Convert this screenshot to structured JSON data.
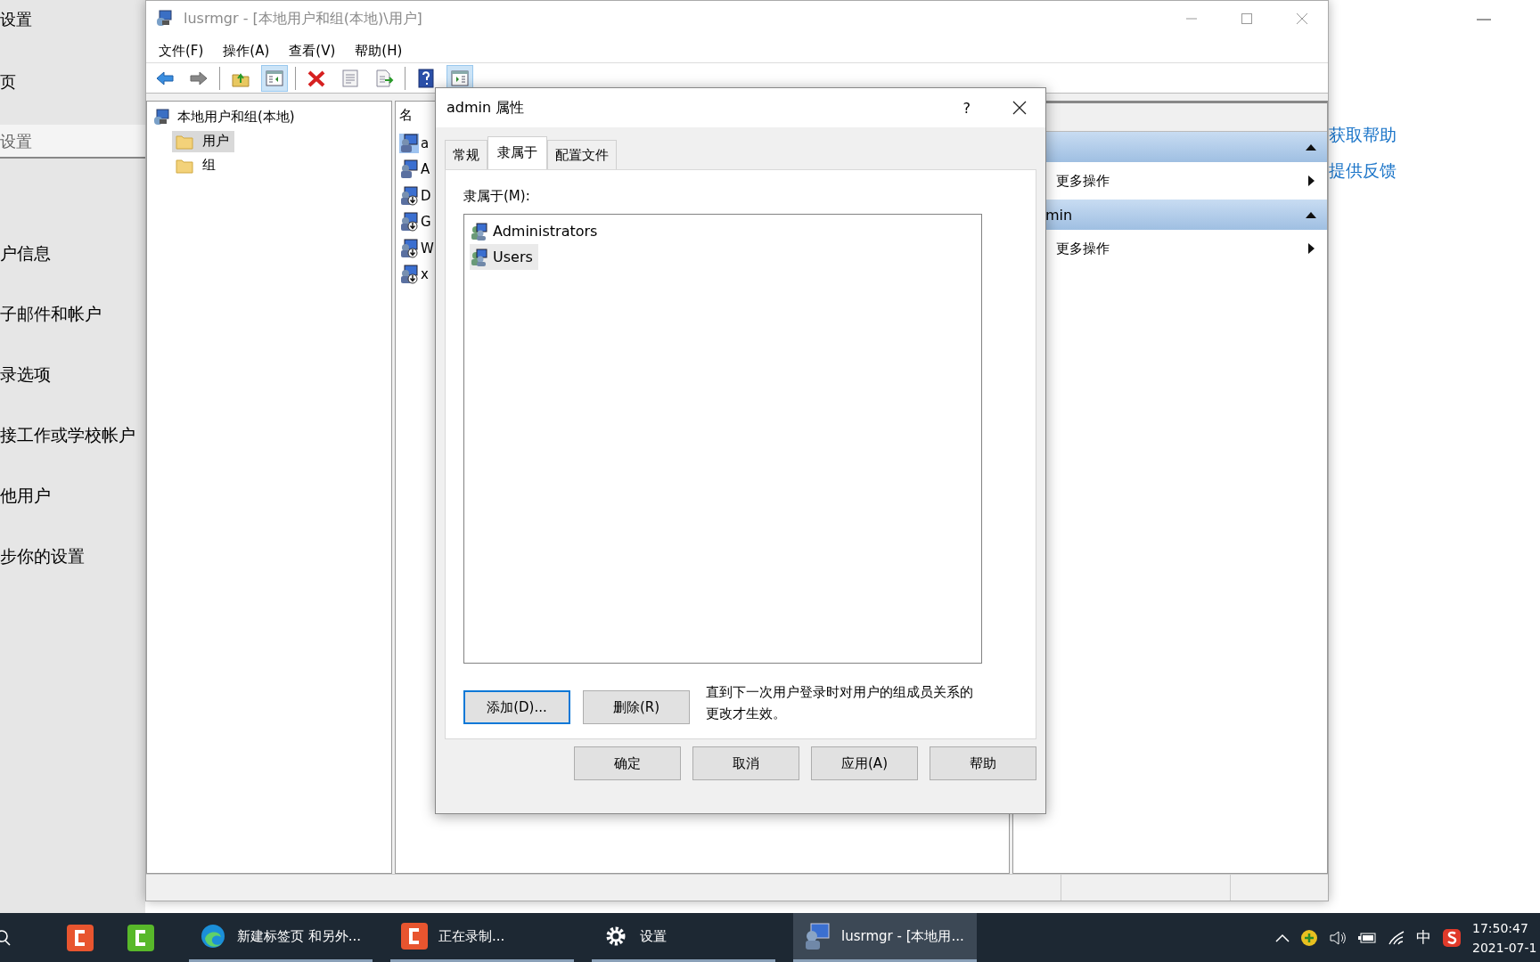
{
  "settings_window": {
    "title": "设置",
    "home": "页",
    "search": {
      "placeholder": "设置"
    },
    "nav_items": [
      "户信息",
      "子邮件和帐户",
      "录选项",
      "接工作或学校帐户",
      "他用户",
      "步你的设置"
    ],
    "links": [
      "获取帮助",
      "提供反馈"
    ]
  },
  "mmc_window": {
    "title": "lusrmgr - [本地用户和组(本地)\\用户]",
    "menu": [
      "文件(F)",
      "操作(A)",
      "查看(V)",
      "帮助(H)"
    ],
    "toolbar": [
      {
        "kind": "back",
        "pressed": false
      },
      {
        "kind": "forward",
        "pressed": false
      },
      {
        "kind": "sep"
      },
      {
        "kind": "up",
        "pressed": false
      },
      {
        "kind": "tree",
        "pressed": true
      },
      {
        "kind": "sep"
      },
      {
        "kind": "delete",
        "pressed": false
      },
      {
        "kind": "properties",
        "pressed": false
      },
      {
        "kind": "export",
        "pressed": false
      },
      {
        "kind": "sep"
      },
      {
        "kind": "help",
        "pressed": false
      },
      {
        "kind": "actionpane",
        "pressed": true
      }
    ],
    "tree": {
      "label": "本地用户和组(本地)",
      "children": [
        {
          "label": "用户",
          "selected": true
        },
        {
          "label": "组",
          "selected": false
        }
      ]
    },
    "list": {
      "column": "名",
      "rows": [
        {
          "text": "a",
          "disabled": false,
          "selected": true
        },
        {
          "text": "A",
          "disabled": false,
          "selected": false
        },
        {
          "text": "D",
          "disabled": true,
          "selected": false
        },
        {
          "text": "G",
          "disabled": true,
          "selected": false
        },
        {
          "text": "W",
          "disabled": true,
          "selected": false
        },
        {
          "text": "x",
          "disabled": true,
          "selected": false
        }
      ]
    },
    "actions": {
      "sections": [
        {
          "items": [
            "更多操作"
          ]
        },
        {
          "title": "min",
          "items": [
            "更多操作"
          ]
        }
      ]
    }
  },
  "dialog": {
    "title": "admin 属性",
    "help": "?",
    "tabs": [
      {
        "label": "常规",
        "selected": false
      },
      {
        "label": "隶属于",
        "selected": true
      },
      {
        "label": "配置文件",
        "selected": false
      }
    ],
    "list_label": "隶属于(M):",
    "groups": [
      {
        "name": "Administrators",
        "selected": false
      },
      {
        "name": "Users",
        "selected": true
      }
    ],
    "list_buttons": [
      {
        "label": "添加(D)...",
        "focused": true
      },
      {
        "label": "删除(R)",
        "focused": false
      }
    ],
    "note": "直到下一次用户登录时对用户的组成员关系的更改才生效。",
    "buttons": [
      "确定",
      "取消",
      "应用(A)",
      "帮助"
    ]
  },
  "taskbar": {
    "items": [
      {
        "kind": "orange-app",
        "active": false
      },
      {
        "kind": "green-app",
        "active": false
      },
      {
        "kind": "edge",
        "label": "新建标签页 和另外...",
        "active": false
      },
      {
        "kind": "orange-app",
        "label": "正在录制...",
        "active": false
      },
      {
        "kind": "gear",
        "label": "设置",
        "active": false
      },
      {
        "kind": "mmc",
        "label": "lusrmgr - [本地用...",
        "active": true
      }
    ],
    "ime": "中",
    "time": "17:50:47",
    "date": "2021-07-1"
  }
}
